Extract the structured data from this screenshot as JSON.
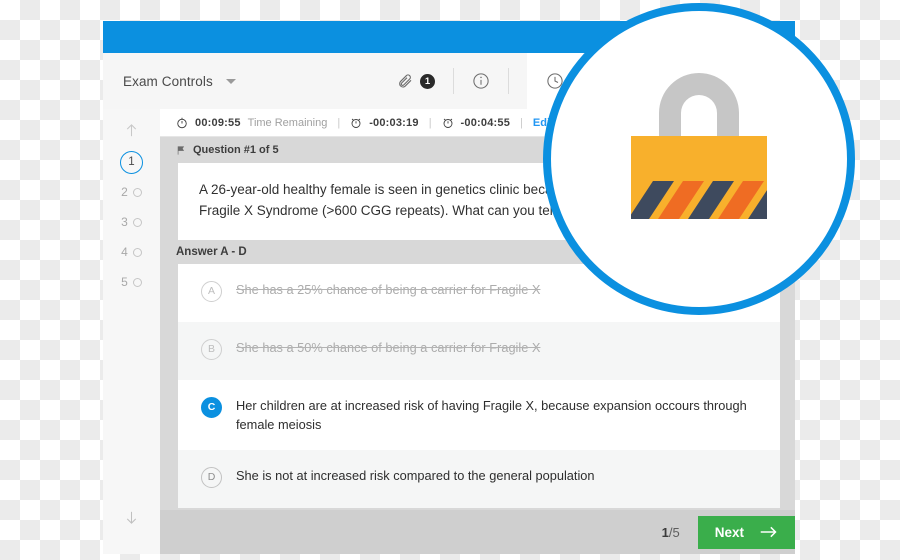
{
  "window": {
    "toolbar": {
      "exam_controls_label": "Exam Controls",
      "attachment_count": "1"
    },
    "timer": {
      "elapsed": "00:09:55",
      "elapsed_label": "Time Remaining",
      "sep1": "|",
      "alarm_1": "-00:03:19",
      "sep2": "|",
      "alarm_2": "-00:04:55",
      "sep3": "|",
      "edit_alarm_label": "Edit Alarm"
    },
    "question": {
      "header": "Question #1 of 5",
      "stem": "A 26-year-old healthy female is seen in genetics clinic because her brother has X-linked Fragile X Syndrome (>600 CGG repeats). What can you tell her?",
      "answers_label": "Answer A - D",
      "options": [
        {
          "letter": "A",
          "text": "She has a 25% chance of being a carrier for Fragile X",
          "state": "struck"
        },
        {
          "letter": "B",
          "text": "She has a 50% chance of being a carrier for Fragile X",
          "state": "struck"
        },
        {
          "letter": "C",
          "text": "Her children are at increased risk of having Fragile X, because expansion occours through female meiosis",
          "state": "selected"
        },
        {
          "letter": "D",
          "text": "She is not at increased risk compared to the general population",
          "state": "normal"
        }
      ]
    },
    "navigation": {
      "up_arrow": "scroll-up",
      "down_arrow": "scroll-down",
      "items": [
        {
          "number": "1",
          "active": true
        },
        {
          "number": "2",
          "active": false
        },
        {
          "number": "3",
          "active": false
        },
        {
          "number": "4",
          "active": false
        },
        {
          "number": "5",
          "active": false
        }
      ]
    },
    "footer": {
      "page_current": "1",
      "page_separator": "/",
      "page_total": "5",
      "next_label": "Next"
    }
  },
  "overlay": {
    "icon": "padlock-icon",
    "ring_color": "#0b90e0",
    "lock_body_color": "#f8b02c",
    "lock_shackle_color": "#c6c6c6",
    "hazard_stripe_colors": [
      "#3e4a5e",
      "#ef6c23"
    ]
  },
  "colors": {
    "brand_blue": "#0b90e0",
    "next_green": "#3aae4b",
    "link_blue": "#2196f3"
  }
}
